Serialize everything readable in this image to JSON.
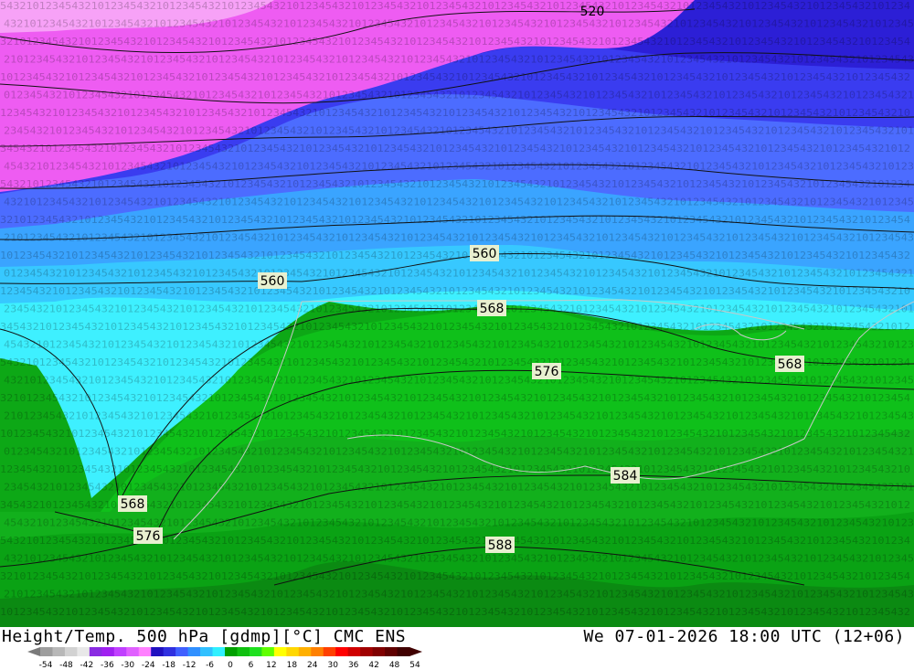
{
  "map": {
    "colors": {
      "magenta": "#ee5cf2",
      "pink": "#f7a2f7",
      "deep_blue": "#2c1fd6",
      "royal_blue": "#3a3cf0",
      "blue": "#4c6cff",
      "sky_blue": "#3aa4ff",
      "light_blue": "#37c8ff",
      "cyan": "#3ef0ff",
      "bright_green": "#0fbf1a",
      "green": "#0aa214",
      "mid_green": "#12a71c",
      "dark_green": "#0b7a11",
      "contour": "#111111",
      "border": "#c8c8c8"
    },
    "contour_labels": [
      {
        "id": "560-center",
        "text": "560"
      },
      {
        "id": "560-left",
        "text": "560"
      },
      {
        "id": "568-center",
        "text": "568"
      },
      {
        "id": "576-center",
        "text": "576"
      },
      {
        "id": "568-right",
        "text": "568"
      },
      {
        "id": "584-center",
        "text": "584"
      },
      {
        "id": "568-left",
        "text": "568"
      },
      {
        "id": "576-left",
        "text": "576"
      },
      {
        "id": "588-center",
        "text": "588"
      },
      {
        "id": "520-top",
        "text": "520"
      }
    ]
  },
  "footer": {
    "title": "Height/Temp. 500 hPa [gdmp][°C] CMC ENS",
    "datetime": "We 07-01-2026 18:00 UTC (12+06)"
  },
  "colorbar": {
    "ticks": [
      "-54",
      "-48",
      "-42",
      "-36",
      "-30",
      "-24",
      "-18",
      "-12",
      "-6",
      "0",
      "6",
      "12",
      "18",
      "24",
      "30",
      "36",
      "42",
      "48",
      "54"
    ],
    "colors": [
      "#9e9e9e",
      "#b8b8b8",
      "#d2d2d2",
      "#e8e8e8",
      "#8a2be2",
      "#a020f0",
      "#c040ff",
      "#e060ff",
      "#ff80ff",
      "#2010c0",
      "#3030e0",
      "#4060ff",
      "#3090ff",
      "#30c0ff",
      "#30f0ff",
      "#00a000",
      "#10c010",
      "#20e020",
      "#60ff00",
      "#ffff00",
      "#ffd700",
      "#ffb000",
      "#ff8000",
      "#ff4000",
      "#ff0000",
      "#d00000",
      "#a00000",
      "#800000",
      "#600000",
      "#400000"
    ]
  }
}
